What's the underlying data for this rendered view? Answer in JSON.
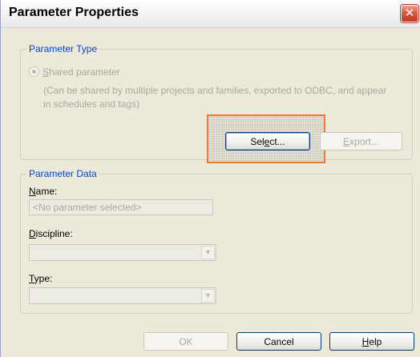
{
  "window": {
    "title": "Parameter Properties",
    "close_glyph": "✕"
  },
  "parameter_type": {
    "legend": "Parameter Type",
    "shared_option": {
      "mnemonic": "S",
      "rest": "hared parameter",
      "selected": true
    },
    "description": "(Can be shared by multiple projects and families, exported to ODBC, and appear in schedules and tags)",
    "select_button": {
      "pre": "Sel",
      "mnemonic": "e",
      "post": "ct..."
    },
    "export_button": {
      "mnemonic": "E",
      "rest": "xport..."
    }
  },
  "parameter_data": {
    "legend": "Parameter Data",
    "name_label": {
      "mnemonic": "N",
      "rest": "ame:"
    },
    "name_value": "<No parameter selected>",
    "discipline_label": {
      "mnemonic": "D",
      "rest": "iscipline:"
    },
    "discipline_value": "",
    "type_label": {
      "mnemonic": "T",
      "rest": "ype:"
    },
    "type_value": ""
  },
  "footer": {
    "ok_label": "OK",
    "cancel_label": "Cancel",
    "help_button": {
      "mnemonic": "H",
      "rest": "elp"
    }
  },
  "icons": {
    "close": "close-icon",
    "combo_arrow": "chevron-down-icon",
    "combo_arrow_glyph": "▼"
  },
  "colors": {
    "dialog_bg": "#ece9d8",
    "legend_text": "#0046d5",
    "highlight_border": "#ef7a2e",
    "close_button": "#d8543a"
  }
}
